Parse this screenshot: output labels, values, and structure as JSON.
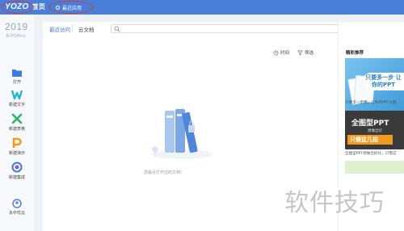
{
  "topbar": {
    "logo_text": "YOZO",
    "home_label": "首页",
    "tab_label": "最近应用"
  },
  "sidebar": {
    "year": "2019",
    "year_sub": "永中Office",
    "items": [
      {
        "label": "打开",
        "icon": "folder-icon",
        "color": "#3f7ae0"
      },
      {
        "label": "新建文字",
        "icon": "word-icon",
        "color": "#29b6d0"
      },
      {
        "label": "新建表格",
        "icon": "sheet-icon",
        "color": "#2fb36a"
      },
      {
        "label": "新建演示",
        "icon": "presentation-icon",
        "color": "#f29a1f"
      },
      {
        "label": "新建集成",
        "icon": "suite-icon",
        "color": "#3f7ae0"
      }
    ],
    "cloud_label": "永中优云"
  },
  "content": {
    "tab_recent": "最近访问",
    "tab_cloud": "云文档",
    "search_placeholder": "",
    "filter_time": "时间",
    "filter_filter": "筛选",
    "empty_text": "您最近打开过的文档!"
  },
  "right_panel": {
    "title": "精彩推荐",
    "card1_text": "只要多一步 让你的PPT",
    "card1_caption": "只要多一步骤，让你的PPT大翻",
    "card2_big": "全图型PPT",
    "card2_small": "想做出好",
    "card2_orange": "只需这几招",
    "card2_caption": "全图型PPT想做出好比，只需这"
  },
  "watermark": "软件技巧",
  "colors": {
    "topbar": "#4a7fd9",
    "accent": "#3f7ae0",
    "annotation_ring": "#d23a3a"
  }
}
